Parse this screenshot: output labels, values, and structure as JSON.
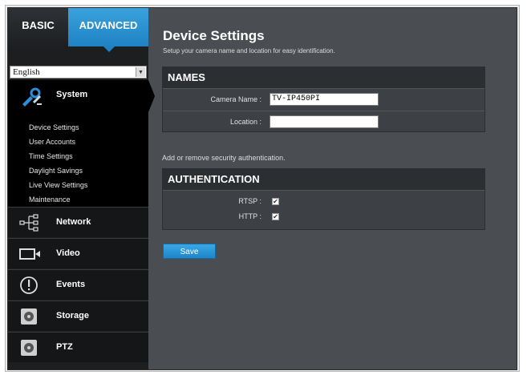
{
  "tabs": {
    "basic": "BASIC",
    "advanced": "ADVANCED"
  },
  "language": {
    "selected": "English"
  },
  "sidebar": {
    "system": {
      "label": "System",
      "items": [
        "Device Settings",
        "User Accounts",
        "Time Settings",
        "Daylight Savings",
        "Live View Settings",
        "Maintenance"
      ]
    },
    "nav": [
      {
        "label": "Network",
        "icon": "network-icon"
      },
      {
        "label": "Video",
        "icon": "video-camera-icon"
      },
      {
        "label": "Events",
        "icon": "alert-icon"
      },
      {
        "label": "Storage",
        "icon": "storage-disk-icon"
      },
      {
        "label": "PTZ",
        "icon": "ptz-icon"
      }
    ]
  },
  "main": {
    "title": "Device Settings",
    "subtitle": "Setup your camera name and location for easy identification.",
    "names": {
      "heading": "NAMES",
      "camera_name_label": "Camera Name :",
      "camera_name_value": "TV-IP450PI",
      "location_label": "Location :",
      "location_value": ""
    },
    "auth_help": "Add or remove security authentication.",
    "auth": {
      "heading": "AUTHENTICATION",
      "rtsp_label": "RTSP :",
      "rtsp_checked": true,
      "http_label": "HTTP :",
      "http_checked": true
    },
    "save_label": "Save"
  },
  "colors": {
    "accent": "#1f82c4",
    "sidebar_bg": "#1c1e20",
    "main_bg": "#4a4e52"
  }
}
